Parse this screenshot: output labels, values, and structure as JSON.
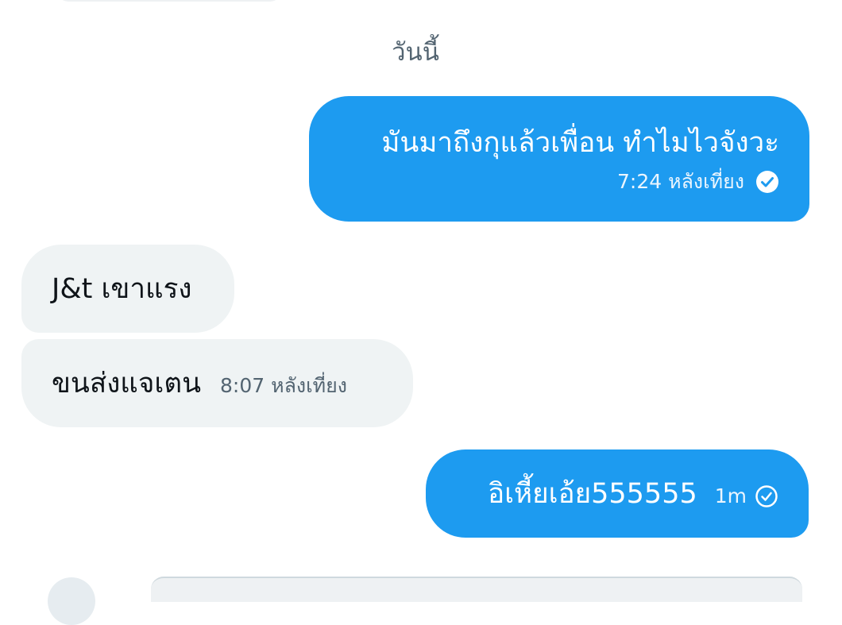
{
  "conversation": {
    "date_separator": "วันนี้",
    "messages": [
      {
        "direction": "outgoing",
        "text": "มันมาถึงกุแล้วเพื่อน ทำไมไวจังวะ",
        "time": "7:24 หลังเที่ยง",
        "status_icon": "check-filled-icon"
      },
      {
        "direction": "incoming",
        "text": "J&t เขาแรง"
      },
      {
        "direction": "incoming",
        "text": "ขนส่งแจเตน",
        "time": "8:07 หลังเที่ยง"
      },
      {
        "direction": "outgoing",
        "text": "อิเหี้ยเอ้ย555555",
        "time": "1m",
        "status_icon": "check-outline-icon"
      }
    ]
  },
  "colors": {
    "outgoing_bubble": "#1d9bf0",
    "incoming_bubble": "#eff3f4",
    "secondary_text": "#536471"
  }
}
